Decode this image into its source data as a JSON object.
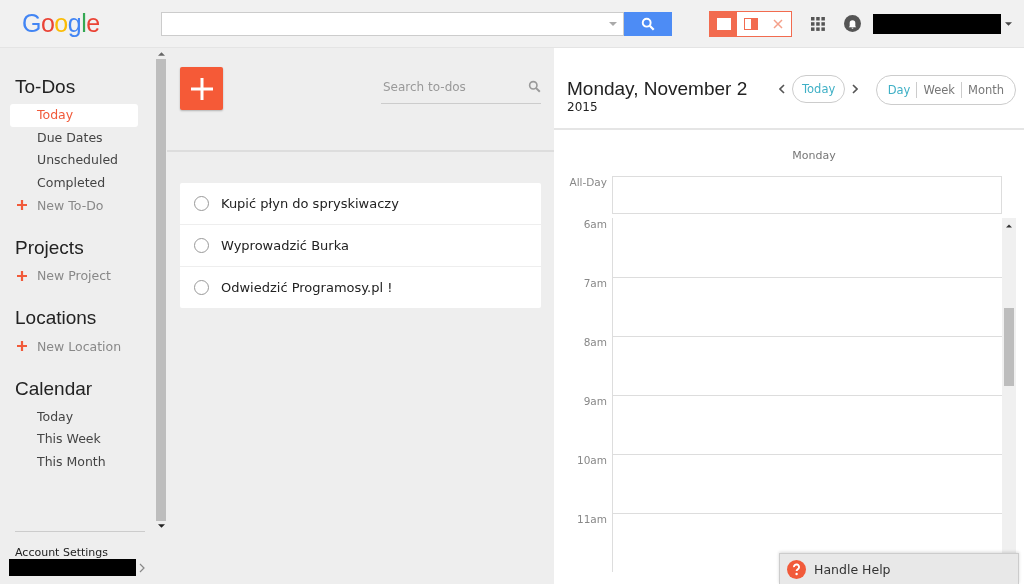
{
  "header": {
    "logo": "Google",
    "view_modes": [
      {
        "kind": "full",
        "selected": true
      },
      {
        "kind": "split",
        "selected": false
      },
      {
        "kind": "close",
        "selected": false
      }
    ]
  },
  "sidebar": {
    "sections": [
      {
        "title": "To-Dos",
        "items": [
          {
            "label": "Today",
            "selected": true,
            "kind": "link"
          },
          {
            "label": "Due Dates",
            "selected": false,
            "kind": "link"
          },
          {
            "label": "Unscheduled",
            "selected": false,
            "kind": "link"
          },
          {
            "label": "Completed",
            "selected": false,
            "kind": "link"
          },
          {
            "label": "New To-Do",
            "kind": "add"
          }
        ]
      },
      {
        "title": "Projects",
        "items": [
          {
            "label": "New Project",
            "kind": "add"
          }
        ]
      },
      {
        "title": "Locations",
        "items": [
          {
            "label": "New Location",
            "kind": "add"
          }
        ]
      },
      {
        "title": "Calendar",
        "items": [
          {
            "label": "Today",
            "selected": false,
            "kind": "link"
          },
          {
            "label": "This Week",
            "selected": false,
            "kind": "link"
          },
          {
            "label": "This Month",
            "selected": false,
            "kind": "link"
          }
        ]
      }
    ],
    "account_settings": "Account Settings"
  },
  "todos": {
    "search": {
      "placeholder": "Search to-dos"
    },
    "items": [
      {
        "text": "Kupić płyn do spryskiwaczy",
        "checked": false
      },
      {
        "text": "Wyprowadzić Burka",
        "checked": false
      },
      {
        "text": "Odwiedzić Programosy.pl !",
        "checked": false
      }
    ]
  },
  "calendar": {
    "date": "Monday, November 2",
    "year": "2015",
    "today_button": "Today",
    "views": [
      {
        "label": "Day",
        "selected": true
      },
      {
        "label": "Week",
        "selected": false
      },
      {
        "label": "Month",
        "selected": false
      }
    ],
    "day_header": "Monday",
    "all_day_label": "All-Day",
    "hours": [
      "6am",
      "7am",
      "8am",
      "9am",
      "10am",
      "11am"
    ]
  },
  "help": {
    "label": "Handle Help"
  }
}
